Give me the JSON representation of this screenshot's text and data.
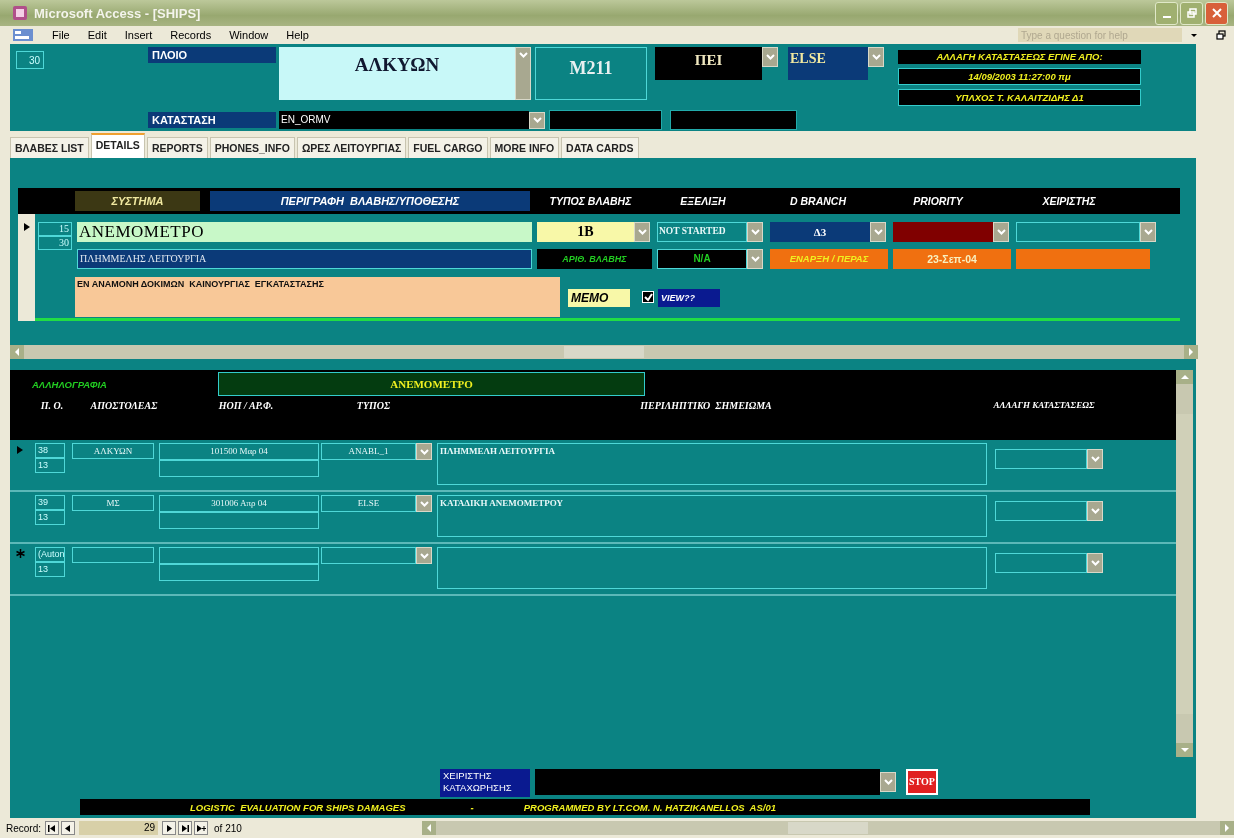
{
  "window": {
    "title": "Microsoft Access - [SHIPS]"
  },
  "menu": [
    "File",
    "Edit",
    "Insert",
    "Records",
    "Window",
    "Help"
  ],
  "help_box": {
    "placeholder": "Type a question for help"
  },
  "header": {
    "record_id": "30",
    "ship_label": "ΠΛΟΙΟ",
    "ship": "ΑΛΚΥΩΝ",
    "code": "M211",
    "ship_type": "ΠΕΙ",
    "category": "ELSE",
    "status_label": "ΚΑΤΑΣΤΑΣΗ",
    "status": "EN_ORMV",
    "status_note": [
      "ΑΛΛΑΓΗ ΚΑΤΑΣΤΑΣΕΩΣ ΕΓΙΝΕ ΑΠΟ:",
      "14/09/2003 11:27:00 πμ",
      "ΥΠΛΧΟΣ Τ. ΚΑΛΑΙΤΖΙΔΗΣ  Δ1"
    ]
  },
  "tabs": [
    {
      "label": "ΒΛΑΒΕΣ  LIST",
      "selected": false
    },
    {
      "label": "DETAILS",
      "selected": true
    },
    {
      "label": "REPORTS",
      "selected": false
    },
    {
      "label": "PHONES_INFO",
      "selected": false
    },
    {
      "label": "ΩΡΕΣ ΛΕΙΤΟΥΡΓΙΑΣ",
      "selected": false
    },
    {
      "label": "FUEL CARGO",
      "selected": false
    },
    {
      "label": "MORE INFO",
      "selected": false
    },
    {
      "label": "DATA CARDS",
      "selected": false
    }
  ],
  "damage": {
    "columns": [
      "ΣΥΣΤΗΜΑ",
      "ΠΕΡΙΓΡΑΦΗ  ΒΛΑΒΗΣ/ΥΠΟΘΕΣΗΣ",
      "ΤΥΠΟΣ ΒΛΑΒΗΣ",
      "ΕΞΕΛΙΞΗ",
      "D BRANCH",
      "PRIORITY",
      "ΧΕΙΡΙΣΤΗΣ"
    ],
    "record": {
      "current": true,
      "ids": [
        "15",
        "30"
      ],
      "system": "ΑΝΕΜΟΜΕΤΡΟ",
      "type": "1B",
      "progress": "NOT STARTED",
      "branch": "Δ3",
      "description": "ΠΛΗΜΜΕΛΗΣ ΛΕΙΤΟΥΡΓΙΑ",
      "number_label": "ΑΡΙΘ. ΒΛΑΒΗΣ",
      "number": "N/A",
      "dates_label": "ΕΝΑΡΞΗ / ΠΕΡΑΣ",
      "start_date": "23-Σεπ-04",
      "notes": "ΕΝ ΑΝΑΜΟΝΗ ΔΟΚΙΜΩΝ  ΚΑΙΝΟΥΡΓΙΑΣ  ΕΓΚΑΤΑΣΤΑΣΗΣ",
      "memo_label": "MEMO",
      "view_checked": true,
      "view_label": "VIEW??"
    }
  },
  "correspondence": {
    "label": "ΑΛΛΗΛΟΓΡΑΦΙΑ",
    "title": "ΑΝΕΜΟΜΕΤΡΟ",
    "columns": [
      "Π. Ο.",
      "ΑΠΟΣΤΟΛΕΑΣ",
      "ΗΟΠ / ΑΡ.Φ.",
      "ΤΥΠΟΣ",
      "ΠΕΡΙΛΗΠΤΙΚΟ  ΣΗΜΕΙΩΜΑ",
      "ΑΛΛΑΓΗ ΚΑΤΑΣΤΑΣΕΩΣ"
    ],
    "rows": [
      {
        "kind": "current",
        "id": "38",
        "sub_id": "13",
        "sender": "ΑΛΚΥΩΝ",
        "reference": "101500 Μαρ 04",
        "type": "ANABL_1",
        "summary": "ΠΛΗΜΜΕΛΗ ΛΕΙΤΟΥΡΓΙΑ"
      },
      {
        "kind": "normal",
        "id": "39",
        "sub_id": "13",
        "sender": "ΜΣ",
        "reference": "301006 Απρ 04",
        "type": "ELSE",
        "summary": "ΚΑΤΑΔΙΚΗ ΑΝΕΜΟΜΕΤΡΟΥ"
      },
      {
        "kind": "new",
        "id": "(Auton",
        "sub_id": "13"
      }
    ]
  },
  "footer": {
    "operator_label": "ΧΕΙΡΙΣΤΗΣ ΚΑΤΑΧΩΡΗΣΗΣ",
    "stop": "STOP",
    "banner_left": "LOGISTIC  EVALUATION FOR SHIPS DAMAGES",
    "banner_sep": "-",
    "banner_right": "PROGRAMMED BY LT.COM. N. HATZIKANELLOS  AS/01"
  },
  "navigation": {
    "label": "Record:",
    "current": "29",
    "total": "of 210"
  }
}
